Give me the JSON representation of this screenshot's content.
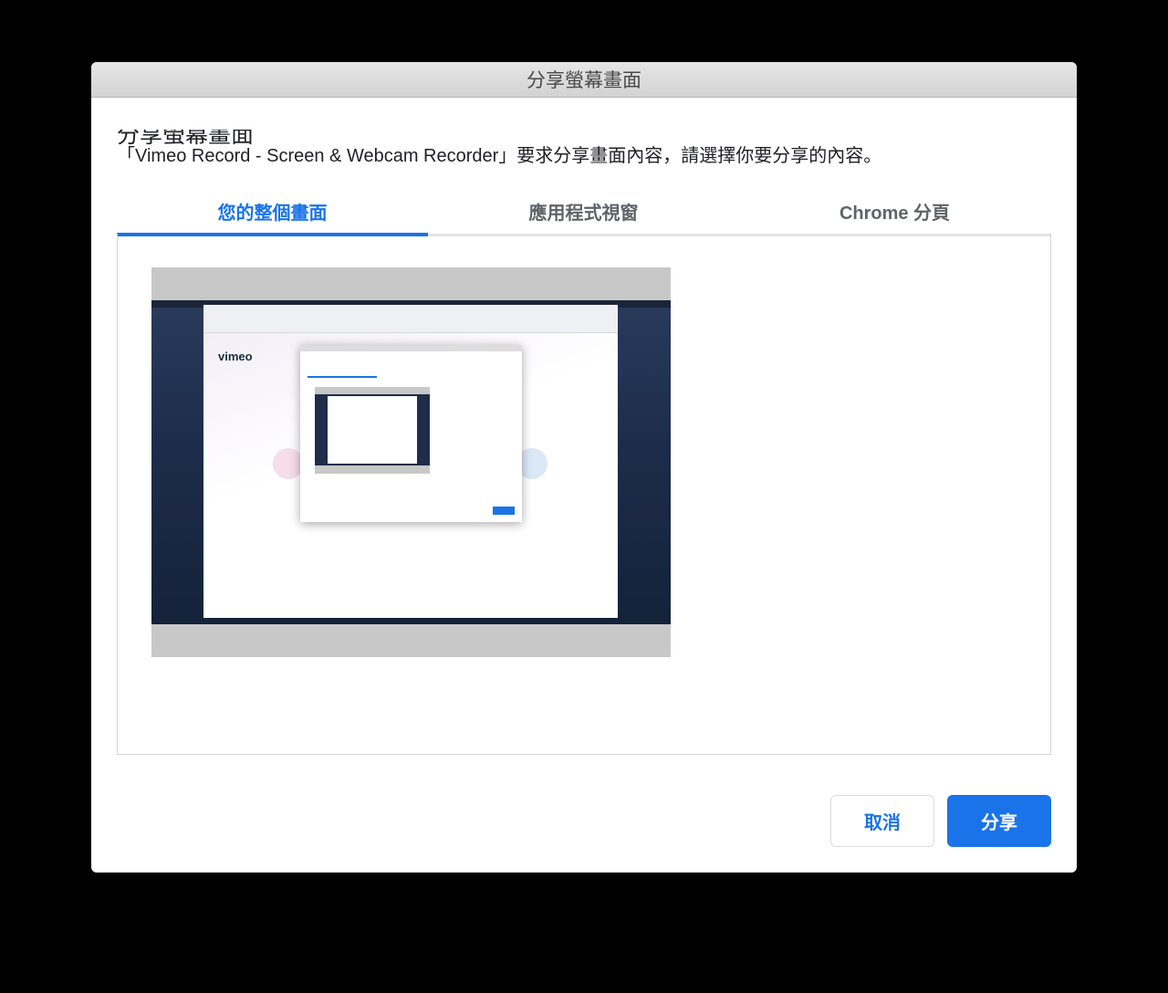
{
  "window": {
    "title": "分享螢幕畫面"
  },
  "dialog": {
    "heading": "分享螢幕畫面",
    "description": "「Vimeo Record - Screen & Webcam Recorder」要求分享畫面內容，請選擇你要分享的內容。"
  },
  "tabs": [
    {
      "label": "您的整個畫面",
      "active": true
    },
    {
      "label": "應用程式視窗",
      "active": false
    },
    {
      "label": "Chrome 分頁",
      "active": false
    }
  ],
  "preview": {
    "page_logo": "vimeo"
  },
  "buttons": {
    "cancel": "取消",
    "share": "分享"
  },
  "colors": {
    "accent": "#1a73e8",
    "text": "#202124",
    "muted": "#5f6368"
  }
}
